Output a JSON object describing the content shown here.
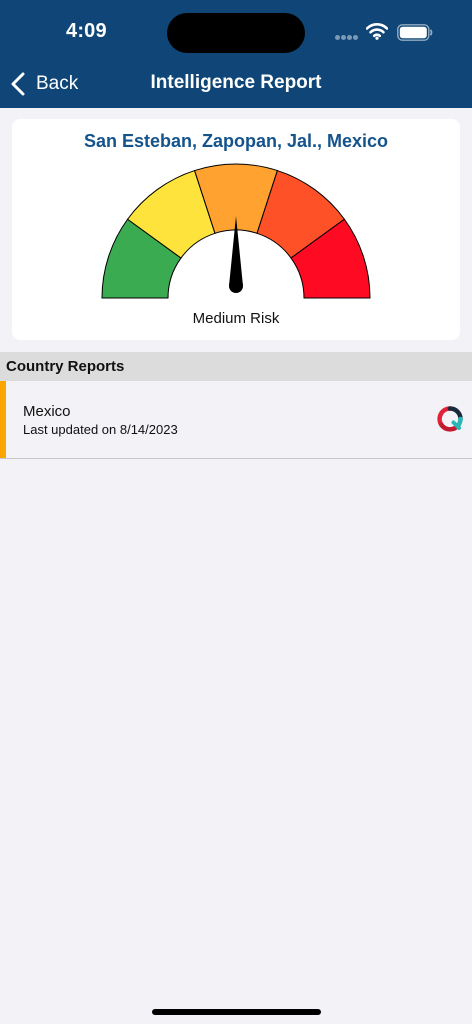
{
  "status_bar": {
    "time": "4:09",
    "icons": [
      "signal-dots-icon",
      "wifi-icon",
      "battery-icon"
    ]
  },
  "nav": {
    "back_label": "Back",
    "title": "Intelligence Report",
    "background_color": "#0f4677"
  },
  "risk_card": {
    "location": "San Esteban, Zapopan, Jal., Mexico",
    "gauge": {
      "segment_colors": [
        "#3bab52",
        "#fde33c",
        "#ffa230",
        "#ff5127",
        "#ff0a23"
      ],
      "needle_level": 0.5
    },
    "risk_label": "Medium Risk"
  },
  "country_reports": {
    "section_title": "Country Reports",
    "items": [
      {
        "name": "Mexico",
        "updated": "Last updated on 8/14/2023",
        "accent_color": "#ffa500",
        "icon": "report-logo-icon"
      }
    ]
  }
}
